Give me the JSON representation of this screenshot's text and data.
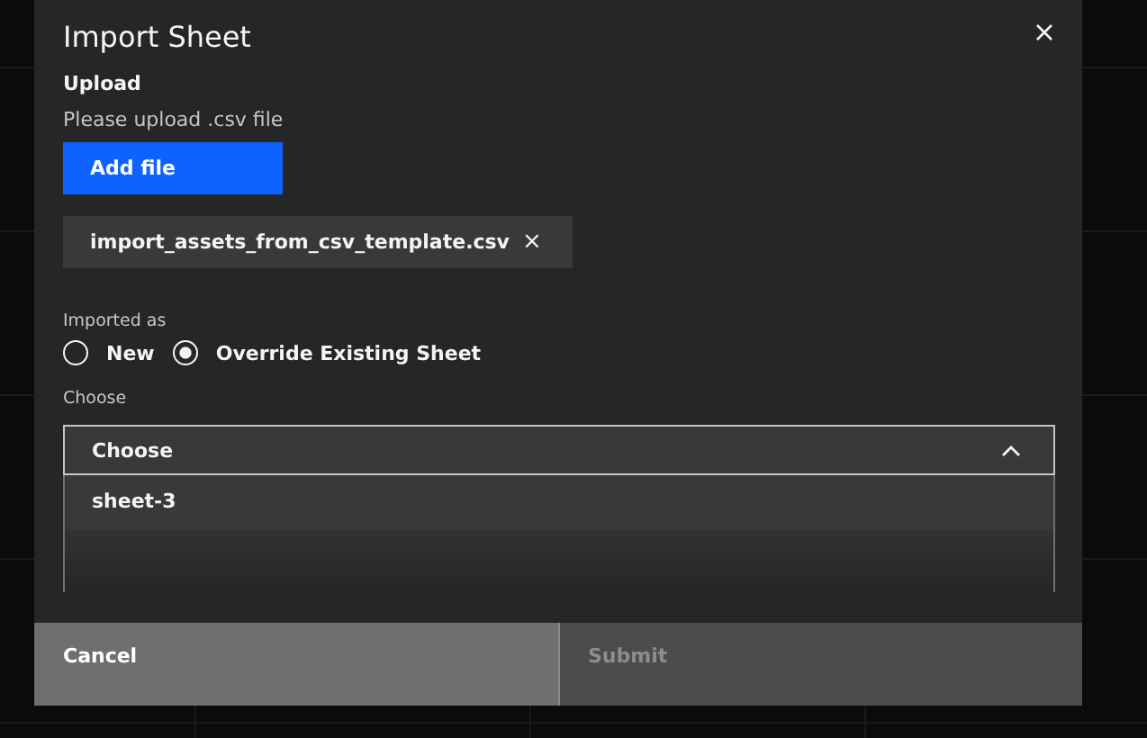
{
  "dialog": {
    "title": "Import Sheet"
  },
  "upload": {
    "heading": "Upload",
    "description": "Please upload .csv file",
    "button": "Add file",
    "file": {
      "name": "import_assets_from_csv_template.csv",
      "remove": "×"
    }
  },
  "imported_as": {
    "label": "Imported as",
    "options": [
      {
        "label": "New",
        "selected": false
      },
      {
        "label": "Override Existing Sheet",
        "selected": true
      }
    ]
  },
  "choose": {
    "label": "Choose",
    "placeholder": "Choose",
    "expanded": true,
    "options": [
      "sheet-3"
    ]
  },
  "footer": {
    "buttons": [
      {
        "label": "Cancel",
        "kind": "secondary",
        "disabled": false
      },
      {
        "label": "Submit",
        "kind": "primary",
        "disabled": true
      }
    ]
  }
}
